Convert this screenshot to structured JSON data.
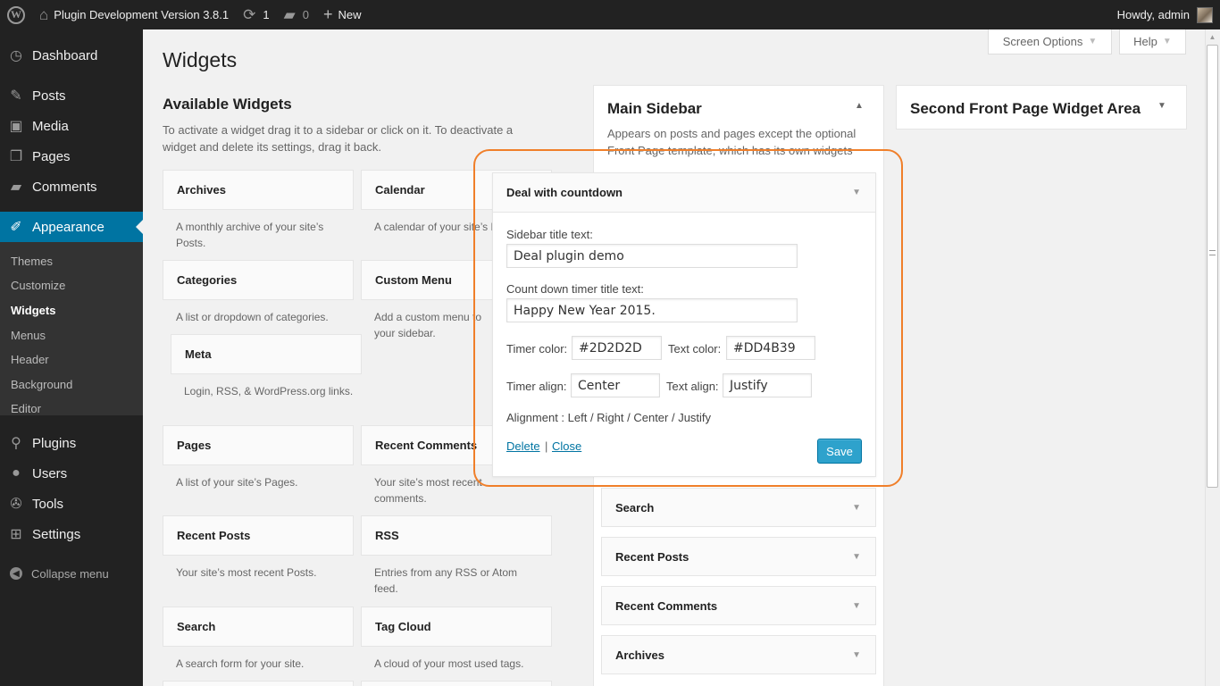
{
  "adminbar": {
    "logo_icon": "wordpress-icon",
    "site_name": "Plugin Development Version 3.8.1",
    "updates_count": "1",
    "comments_count": "0",
    "new_label": "New",
    "howdy": "Howdy, admin"
  },
  "menu": {
    "dashboard": "Dashboard",
    "posts": "Posts",
    "media": "Media",
    "pages": "Pages",
    "comments": "Comments",
    "appearance": "Appearance",
    "sub": {
      "themes": "Themes",
      "customize": "Customize",
      "widgets": "Widgets",
      "menus": "Menus",
      "header": "Header",
      "background": "Background",
      "editor": "Editor"
    },
    "plugins": "Plugins",
    "users": "Users",
    "tools": "Tools",
    "settings": "Settings",
    "collapse": "Collapse menu"
  },
  "screen_options": "Screen Options",
  "help": "Help",
  "page_title": "Widgets",
  "available": {
    "title": "Available Widgets",
    "description": "To activate a widget drag it to a sidebar or click on it. To deactivate a widget and delete its settings, drag it back.",
    "widgets": {
      "archives": {
        "title": "Archives",
        "desc": "A monthly archive of your site’s Posts."
      },
      "calendar": {
        "title": "Calendar",
        "desc": "A calendar of your site’s Posts."
      },
      "categories": {
        "title": "Categories",
        "desc": "A list or dropdown of categories."
      },
      "custom_menu": {
        "title": "Custom Menu",
        "desc": "Add a custom menu to your sidebar."
      },
      "meta": {
        "title": "Meta",
        "desc": "Login, RSS, & WordPress.org links."
      },
      "pages": {
        "title": "Pages",
        "desc": "A list of your site’s Pages."
      },
      "recent_comments": {
        "title": "Recent Comments",
        "desc": "Your site’s most recent comments."
      },
      "recent_posts": {
        "title": "Recent Posts",
        "desc": "Your site’s most recent Posts."
      },
      "rss": {
        "title": "RSS",
        "desc": "Entries from any RSS or Atom feed."
      },
      "search": {
        "title": "Search",
        "desc": "A search form for your site."
      },
      "tag_cloud": {
        "title": "Tag Cloud",
        "desc": "A cloud of your most used tags."
      }
    }
  },
  "main_sidebar": {
    "title": "Main Sidebar",
    "description": "Appears on posts and pages except the optional Front Page template, which has its own widgets",
    "widgets": [
      "Search",
      "Recent Posts",
      "Recent Comments",
      "Archives"
    ]
  },
  "second_sidebar": {
    "title": "Second Front Page Widget Area"
  },
  "deal_widget": {
    "title": "Deal with countdown",
    "sidebar_title_label": "Sidebar title text:",
    "sidebar_title_value": "Deal plugin demo",
    "countdown_label": "Count down timer title text:",
    "countdown_value": "Happy New Year 2015.",
    "timer_color_label": "Timer color:",
    "timer_color_value": "#2D2D2D",
    "text_color_label": "Text color:",
    "text_color_value": "#DD4B39",
    "timer_align_label": "Timer align:",
    "timer_align_value": "Center",
    "text_align_label": "Text align:",
    "text_align_value": "Justify",
    "alignment_note": "Alignment : Left / Right / Center / Justify",
    "delete_label": "Delete",
    "separator": "|",
    "close_label": "Close",
    "save_label": "Save"
  },
  "colors": {
    "admin_bar": "#222222",
    "menu_current": "#0074a2",
    "save_button": "#2ea2cc",
    "highlight": "#f07f2a"
  }
}
